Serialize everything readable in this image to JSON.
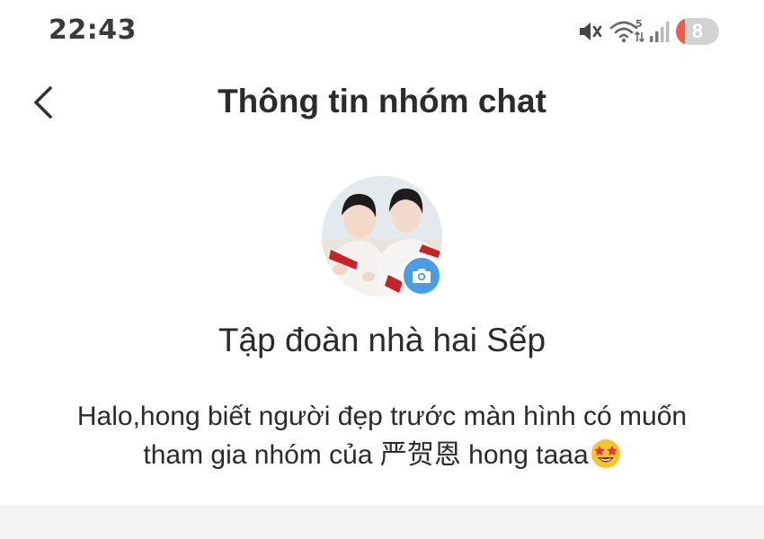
{
  "status_bar": {
    "time": "22:43",
    "battery_level": "8",
    "icons": [
      "mute-icon",
      "wifi-icon",
      "signal-icon",
      "battery-icon"
    ],
    "battery_color": "#ef5a4f"
  },
  "header": {
    "title": "Thông tin nhóm chat",
    "back_icon": "chevron-left-icon"
  },
  "group": {
    "avatar_icon": "group-avatar",
    "camera_icon": "camera-icon",
    "camera_badge_color": "#4a9be8",
    "name": "Tập đoàn nhà hai Sếp",
    "description_line1": "Halo,hong biết người đẹp trước màn hình có muốn",
    "description_line2": "tham gia nhóm của 严贺恩 hong taaa",
    "emoji": "star-struck-emoji"
  }
}
